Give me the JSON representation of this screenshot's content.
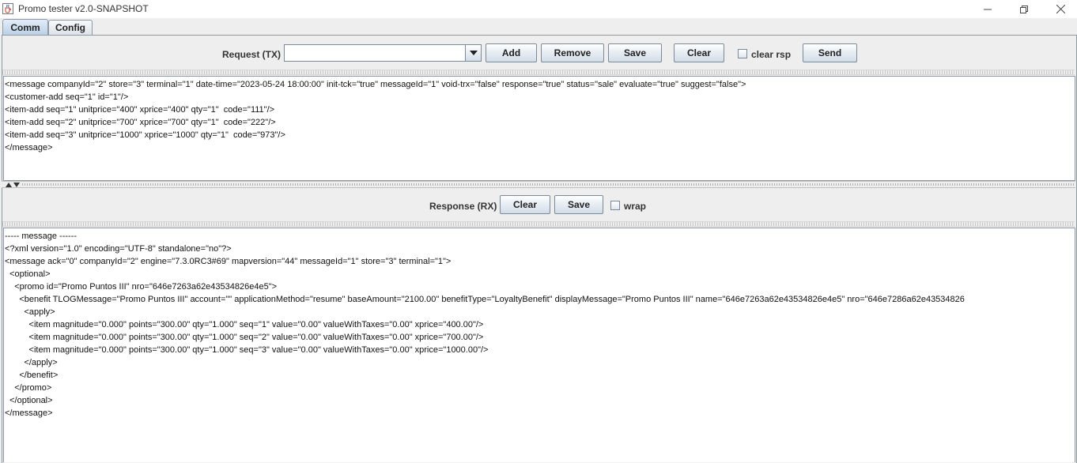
{
  "window": {
    "title": "Promo tester v2.0-SNAPSHOT",
    "icon": "java-cup-icon",
    "controls": [
      "minimize-icon",
      "restore-icon",
      "close-icon"
    ]
  },
  "tabs": [
    {
      "label": "Comm",
      "active": true
    },
    {
      "label": "Config",
      "active": false
    }
  ],
  "request": {
    "label": "Request (TX)",
    "combo_value": "",
    "buttons": {
      "add": "Add",
      "remove": "Remove",
      "save": "Save",
      "clear": "Clear",
      "send": "Send"
    },
    "clear_rsp": {
      "label": "clear rsp",
      "checked": false
    },
    "text": "<message companyId=\"2\" store=\"3\" terminal=\"1\" date-time=\"2023-05-24 18:00:00\" init-tck=\"true\" messageId=\"1\" void-trx=\"false\" response=\"true\" status=\"sale\" evaluate=\"true\" suggest=\"false\">\n<customer-add seq=\"1\" id=\"1\"/>\n<item-add seq=\"1\" unitprice=\"400\" xprice=\"400\" qty=\"1\"  code=\"111\"/>\n<item-add seq=\"2\" unitprice=\"700\" xprice=\"700\" qty=\"1\"  code=\"222\"/>\n<item-add seq=\"3\" unitprice=\"1000\" xprice=\"1000\" qty=\"1\"  code=\"973\"/>\n</message>"
  },
  "response": {
    "label": "Response (RX)",
    "buttons": {
      "clear": "Clear",
      "save": "Save"
    },
    "wrap": {
      "label": "wrap",
      "checked": false
    },
    "text": "----- message ------\n<?xml version=\"1.0\" encoding=\"UTF-8\" standalone=\"no\"?>\n<message ack=\"0\" companyId=\"2\" engine=\"7.3.0RC3#69\" mapversion=\"44\" messageId=\"1\" store=\"3\" terminal=\"1\">\n  <optional>\n    <promo id=\"Promo Puntos III\" nro=\"646e7263a62e43534826e4e5\">\n      <benefit TLOGMessage=\"Promo Puntos III\" account=\"\" applicationMethod=\"resume\" baseAmount=\"2100.00\" benefitType=\"LoyaltyBenefit\" displayMessage=\"Promo Puntos III\" name=\"646e7263a62e43534826e4e5\" nro=\"646e7286a62e43534826\n        <apply>\n          <item magnitude=\"0.000\" points=\"300.00\" qty=\"1.000\" seq=\"1\" value=\"0.00\" valueWithTaxes=\"0.00\" xprice=\"400.00\"/>\n          <item magnitude=\"0.000\" points=\"300.00\" qty=\"1.000\" seq=\"2\" value=\"0.00\" valueWithTaxes=\"0.00\" xprice=\"700.00\"/>\n          <item magnitude=\"0.000\" points=\"300.00\" qty=\"1.000\" seq=\"3\" value=\"0.00\" valueWithTaxes=\"0.00\" xprice=\"1000.00\"/>\n        </apply>\n      </benefit>\n    </promo>\n  </optional>\n</message>"
  }
}
